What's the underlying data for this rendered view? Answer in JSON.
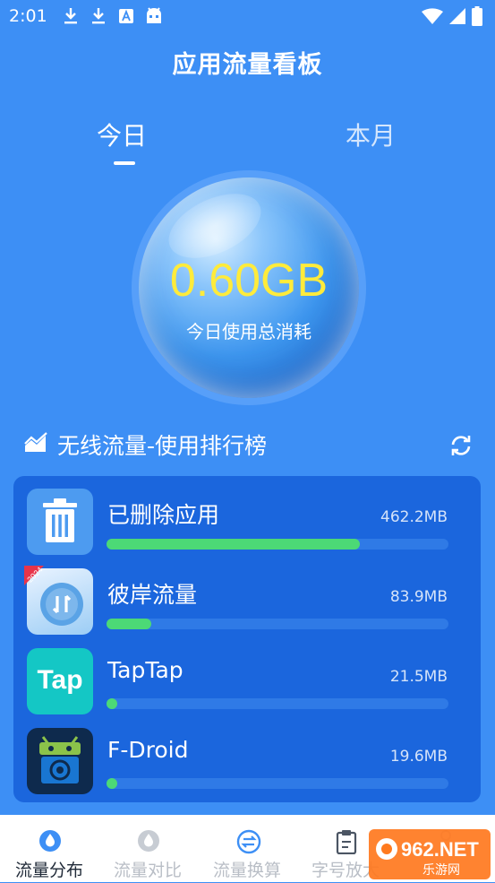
{
  "status_bar": {
    "time": "2:01",
    "notification_icons": [
      "download-icon",
      "download-icon",
      "font-icon",
      "android-icon"
    ],
    "system_icons": [
      "wifi-icon",
      "signal-icon",
      "battery-icon"
    ]
  },
  "header": {
    "title": "应用流量看板"
  },
  "tabs": [
    {
      "label": "今日",
      "selected": true
    },
    {
      "label": "本月",
      "selected": false
    }
  ],
  "summary": {
    "value": "0.60GB",
    "label": "今日使用总消耗"
  },
  "ranking": {
    "title": "无线流量-使用排行榜",
    "items": [
      {
        "name": "已删除应用",
        "usage": "462.2MB",
        "fraction": 0.74
      },
      {
        "name": "彼岸流量",
        "usage": "83.9MB",
        "fraction": 0.13,
        "badge": "2024"
      },
      {
        "name": "TapTap",
        "usage": "21.5MB",
        "fraction": 0.03,
        "icon_text": "Tap"
      },
      {
        "name": "F-Droid",
        "usage": "19.6MB",
        "fraction": 0.03
      }
    ]
  },
  "bottom_nav": [
    {
      "label": "流量分布",
      "icon": "drop-icon",
      "active": true
    },
    {
      "label": "流量对比",
      "icon": "drop-icon",
      "active": false
    },
    {
      "label": "流量换算",
      "icon": "exchange-icon",
      "active": false
    },
    {
      "label": "字号放大",
      "icon": "clipboard-icon",
      "active": false
    },
    {
      "label": "",
      "icon": "info-icon",
      "active": false
    }
  ],
  "watermark": "962.NET 乐游网",
  "colors": {
    "background": "#3d8ff5",
    "card": "#1b66dd",
    "bar_fill": "#4cd976",
    "bar_track": "#2f7ae6",
    "value_text": "#ffeb3b",
    "nav_active": "#1f2937",
    "nav_inactive": "#b9bec6",
    "nav_icon_active": "#3d8ff5"
  }
}
